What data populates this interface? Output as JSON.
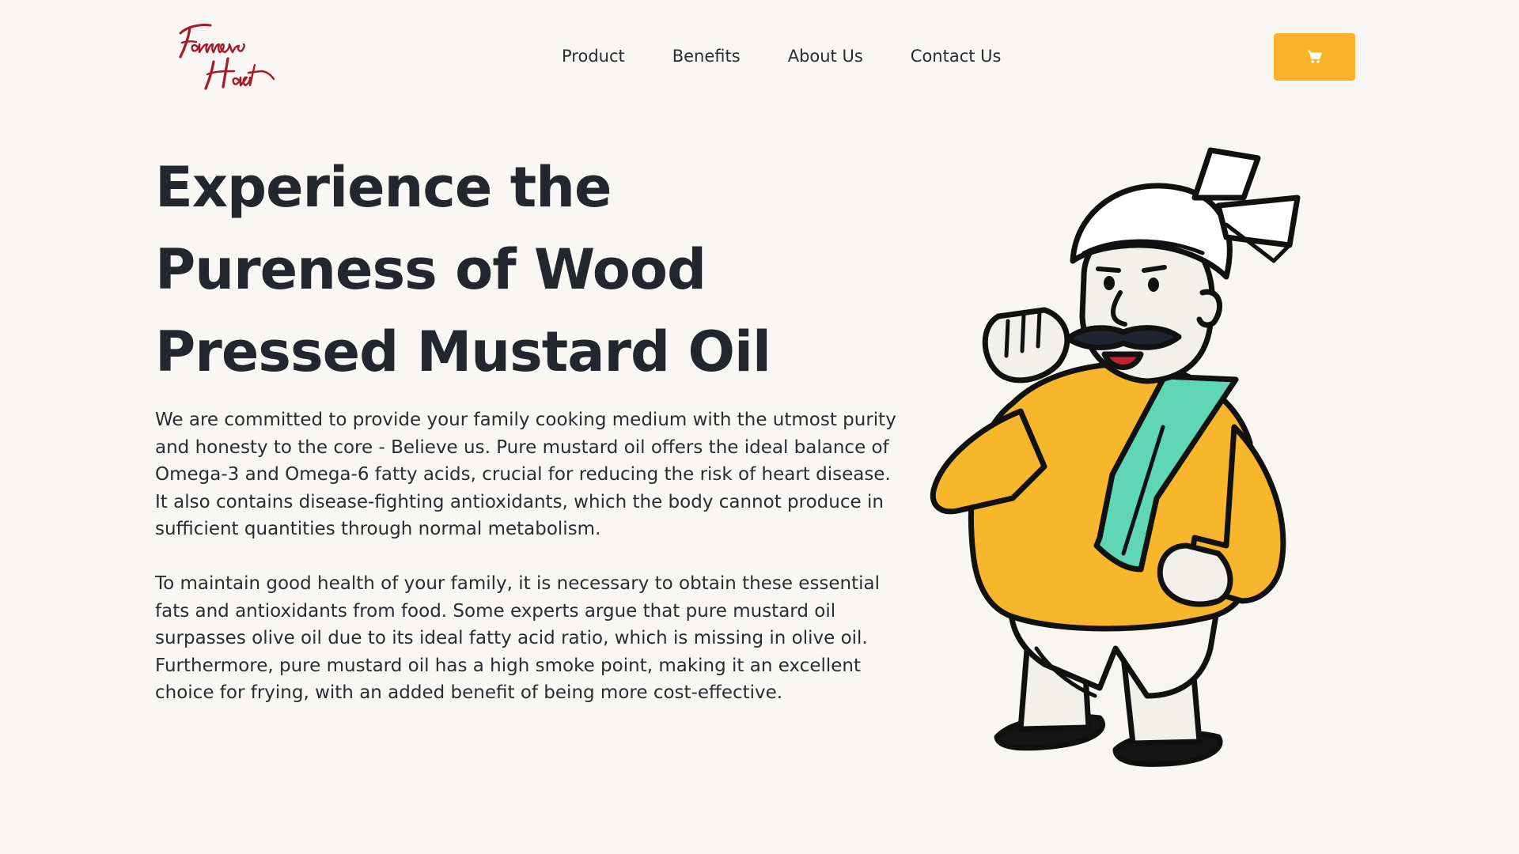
{
  "header": {
    "logo_text": "Farmers Haat",
    "nav": [
      {
        "label": "Product"
      },
      {
        "label": "Benefits"
      },
      {
        "label": "About Us"
      },
      {
        "label": "Contact Us"
      }
    ],
    "cart_icon": "shopping-cart-icon"
  },
  "hero": {
    "title": "Experience the Pureness of Wood Pressed Mustard Oil",
    "paragraphs": [
      "We are committed to provide your family cooking medium with the utmost purity and honesty to the core - Believe us. Pure mustard oil offers the ideal balance of Omega-3 and Omega-6 fatty acids, crucial for reducing the risk of heart disease. It also contains disease-fighting antioxidants, which the body cannot produce in sufficient quantities through normal metabolism.",
      "To maintain good health of your family, it is necessary to obtain these essential fats and antioxidants from food. Some experts argue that pure mustard oil surpasses olive oil due to its ideal fatty acid ratio, which is missing in olive oil. Furthermore, pure mustard oil has a high smoke point, making it an excellent choice for frying, with an added benefit of being more cost-effective."
    ]
  },
  "colors": {
    "background": "#f8f7f3",
    "accent": "#fbb32b",
    "logo_red": "#a8182a",
    "text": "#23262d",
    "kurta": "#f7b62c",
    "scarf": "#5fd6b4"
  }
}
